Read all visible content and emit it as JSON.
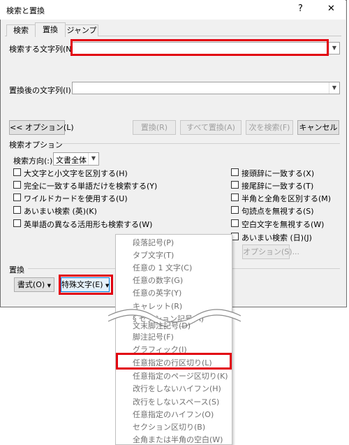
{
  "window": {
    "title": "検索と置換",
    "help_glyph": "?",
    "close_glyph": "✕"
  },
  "tabs": [
    {
      "label": "検索"
    },
    {
      "label": "置換"
    },
    {
      "label": "ジャンプ"
    }
  ],
  "find": {
    "label": "検索する文字列(N):",
    "value": ""
  },
  "replace": {
    "label": "置換後の文字列(I):",
    "value": ""
  },
  "buttons": {
    "options": "<< オプション(L)",
    "replace": "置換(R)",
    "replace_all": "すべて置換(A)",
    "find_next": "次を検索(F)",
    "cancel": "キャンセル",
    "options_small": "オプション(S)...",
    "format": "書式(O)",
    "special": "特殊文字(E)"
  },
  "search_options": {
    "heading": "検索オプション",
    "direction_label": "検索方向(:)",
    "direction_value": "文書全体",
    "left_checkboxes": [
      {
        "label": "大文字と小文字を区別する(H)",
        "checked": false
      },
      {
        "label": "完全に一致する単語だけを検索する(Y)",
        "checked": false
      },
      {
        "label": "ワイルドカードを使用する(U)",
        "checked": false
      },
      {
        "label": "あいまい検索 (英)(K)",
        "checked": false
      },
      {
        "label": "英単語の異なる活用形も検索する(W)",
        "checked": false
      }
    ],
    "right_checkboxes": [
      {
        "label": "接頭辞に一致する(X)",
        "checked": false
      },
      {
        "label": "接尾辞に一致する(T)",
        "checked": false
      },
      {
        "label": "半角と全角を区別する(M)",
        "checked": false
      },
      {
        "label": "句読点を無視する(S)",
        "checked": false
      },
      {
        "label": "空白文字を無視する(W)",
        "checked": false
      },
      {
        "label": "あいまい検索 (日)(J)",
        "checked": false
      }
    ]
  },
  "replace_section": {
    "heading": "置換"
  },
  "special_menu": {
    "items": [
      {
        "label": "段落記号(P)",
        "enabled": false
      },
      {
        "label": "タブ文字(T)",
        "enabled": false
      },
      {
        "label": "任意の 1 文字(C)",
        "enabled": false
      },
      {
        "label": "任意の数字(G)",
        "enabled": false
      },
      {
        "label": "任意の英字(Y)",
        "enabled": false
      },
      {
        "label": "キャレット(R)",
        "enabled": false
      },
      {
        "label": "§ セクション記号(A)",
        "enabled": false
      },
      {
        "label": "文末脚注記号(D)",
        "enabled": false
      },
      {
        "label": "脚注記号(F)",
        "enabled": false
      },
      {
        "label": "グラフィック(I)",
        "enabled": false
      },
      {
        "label": "任意指定の行区切り(L)",
        "enabled": false
      },
      {
        "label": "任意指定のページ区切り(K)",
        "enabled": false
      },
      {
        "label": "改行をしないハイフン(H)",
        "enabled": false
      },
      {
        "label": "改行をしないスペース(S)",
        "enabled": false
      },
      {
        "label": "任意指定のハイフン(O)",
        "enabled": false
      },
      {
        "label": "セクション区切り(B)",
        "enabled": false
      },
      {
        "label": "全角または半角の空白(W)",
        "enabled": false
      }
    ]
  },
  "colors": {
    "highlight": "#e2000f",
    "dialog_bg": "#f0f0f0"
  }
}
